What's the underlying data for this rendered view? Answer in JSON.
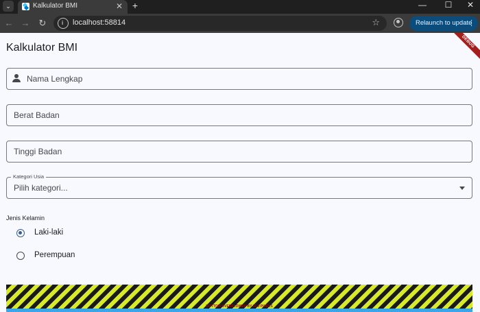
{
  "browser": {
    "tab_title": "Kalkulator BMI",
    "tab_list_icon": "chevron-down-icon",
    "tab_close_icon": "close-icon",
    "new_tab_icon": "plus-icon",
    "url": "localhost:58814",
    "relaunch_label": "Relaunch to update",
    "accent_color": "#0b4c7b"
  },
  "app": {
    "title": "Kalkulator BMI",
    "debug_banner": "DEBUG",
    "fields": {
      "name_label": "Nama Lengkap",
      "weight_label": "Berat Badan",
      "height_label": "Tinggi Badan"
    },
    "age_dropdown": {
      "label": "Kategori Usia",
      "placeholder": "Pilih kategori..."
    },
    "gender": {
      "label": "Jenis Kelamin",
      "options": [
        {
          "label": "Laki-laki",
          "selected": true
        },
        {
          "label": "Perempuan",
          "selected": false
        }
      ]
    },
    "overflow_message": "BOTTOM OVERFLOWED BY 10.0 PIXELS",
    "primary_color": "#3a5f8f"
  }
}
